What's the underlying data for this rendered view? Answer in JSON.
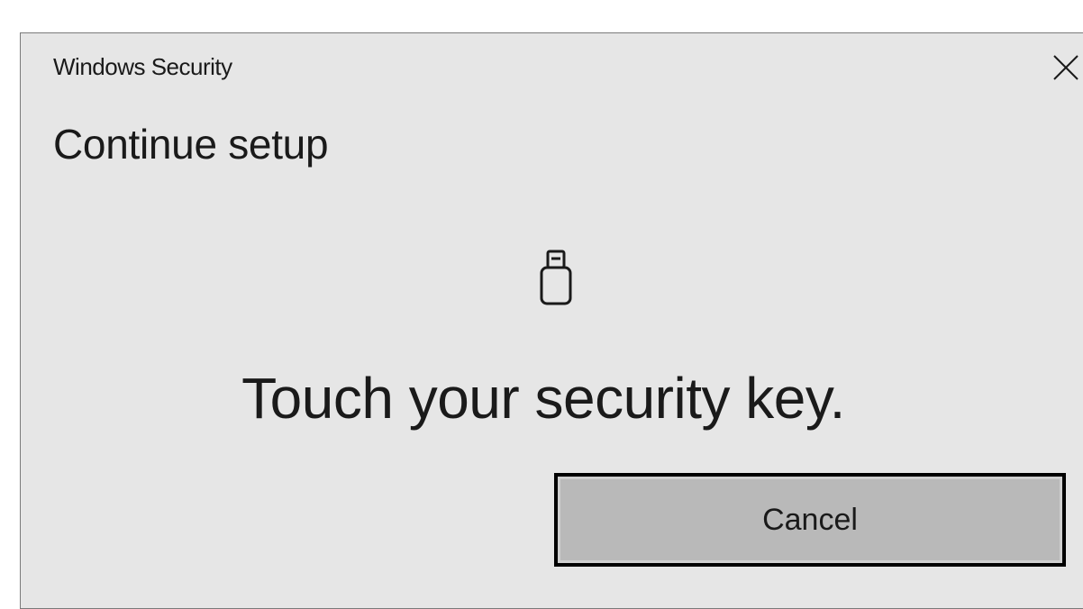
{
  "window": {
    "title": "Windows Security",
    "close_icon": "close-icon"
  },
  "dialog": {
    "heading": "Continue setup",
    "icon": "usb-security-key-icon",
    "prompt": "Touch your security key.",
    "cancel_label": "Cancel"
  },
  "colors": {
    "dialog_background": "#e6e6e6",
    "button_background": "#b9b9b9",
    "button_border": "#000000",
    "text": "#1a1a1a"
  }
}
